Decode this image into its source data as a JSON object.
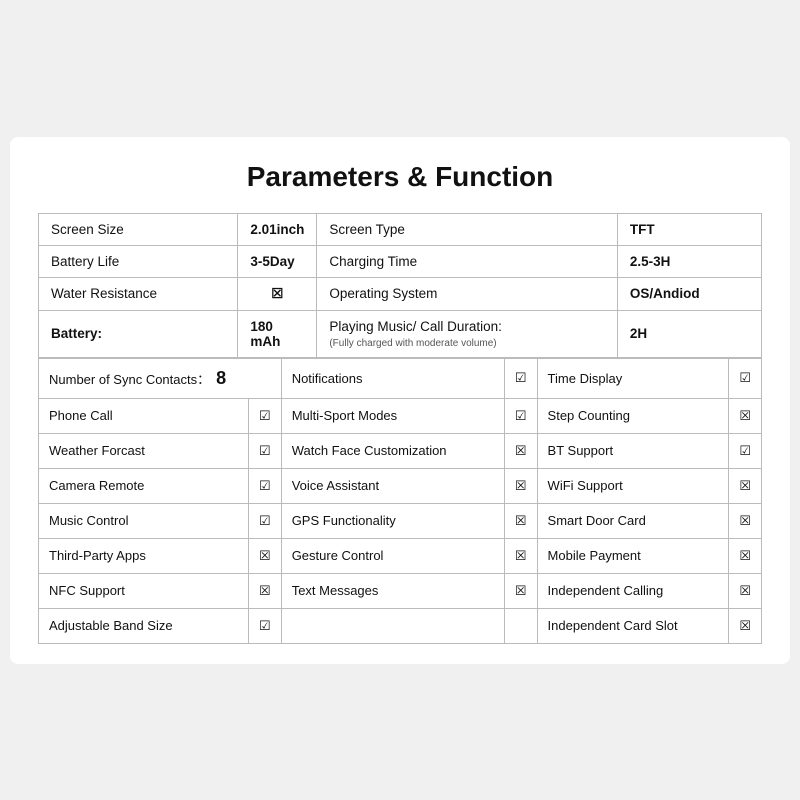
{
  "title": "Parameters & Function",
  "specs": [
    {
      "left_label": "Screen Size",
      "left_value": "2.01inch",
      "right_label": "Screen Type",
      "right_value": "TFT"
    },
    {
      "left_label": "Battery Life",
      "left_value": "3-5Day",
      "right_label": "Charging Time",
      "right_value": "2.5-3H"
    },
    {
      "left_label": "Water Resistance",
      "left_value": "☒",
      "right_label": "Operating System",
      "right_value": "OS/Andiod"
    },
    {
      "left_label": "Battery:",
      "left_value": "180 mAh",
      "right_label": "Playing Music/ Call Duration:\n(Fully charged with moderate volume)",
      "right_value": "2H"
    }
  ],
  "features": {
    "header_contacts": "Number of Sync Contacts：",
    "header_contacts_value": "8",
    "cols": [
      {
        "label": "Notifications",
        "check": "yes"
      },
      {
        "label": "Time Display",
        "check": "yes"
      }
    ],
    "rows": [
      [
        {
          "label": "Phone Call",
          "check": "yes"
        },
        {
          "label": "Multi-Sport Modes",
          "check": "yes"
        },
        {
          "label": "Step Counting",
          "check": "no"
        }
      ],
      [
        {
          "label": "Weather Forcast",
          "check": "yes"
        },
        {
          "label": "Watch Face Customization",
          "check": "no"
        },
        {
          "label": "BT Support",
          "check": "yes"
        }
      ],
      [
        {
          "label": "Camera Remote",
          "check": "yes"
        },
        {
          "label": "Voice Assistant",
          "check": "no"
        },
        {
          "label": "WiFi Support",
          "check": "no"
        }
      ],
      [
        {
          "label": "Music Control",
          "check": "yes"
        },
        {
          "label": "GPS Functionality",
          "check": "no"
        },
        {
          "label": "Smart Door Card",
          "check": "no"
        }
      ],
      [
        {
          "label": "Third-Party Apps",
          "check": "no"
        },
        {
          "label": "Gesture Control",
          "check": "no"
        },
        {
          "label": "Mobile Payment",
          "check": "no"
        }
      ],
      [
        {
          "label": "NFC Support",
          "check": "no"
        },
        {
          "label": "Text Messages",
          "check": "no"
        },
        {
          "label": "Independent Calling",
          "check": "no"
        }
      ],
      [
        {
          "label": "Adjustable Band Size",
          "check": "yes"
        },
        {
          "label": "",
          "check": ""
        },
        {
          "label": "Independent Card Slot",
          "check": "no"
        }
      ]
    ]
  },
  "icons": {
    "check_yes": "☑",
    "check_no": "☒"
  }
}
